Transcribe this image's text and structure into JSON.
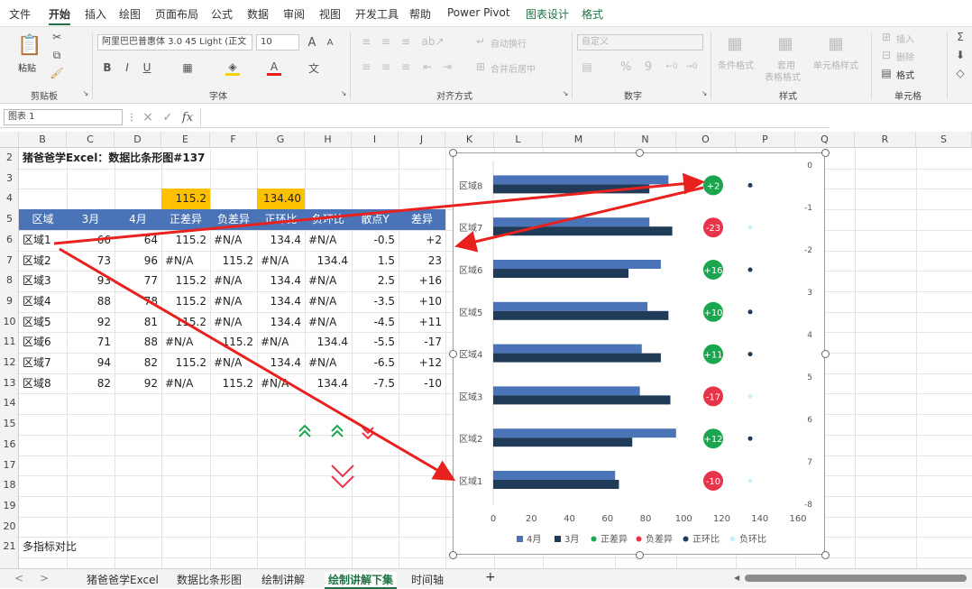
{
  "menu": {
    "items": [
      "文件",
      "开始",
      "插入",
      "绘图",
      "页面布局",
      "公式",
      "数据",
      "审阅",
      "视图",
      "开发工具",
      "帮助",
      "Power Pivot",
      "图表设计",
      "格式"
    ]
  },
  "ribbon": {
    "clipboard": {
      "paste": "粘贴",
      "label": "剪贴板"
    },
    "font": {
      "name": "阿里巴巴普惠体 3.0 45 Light (正文",
      "size": "10",
      "label": "字体",
      "bold": "B",
      "italic": "I",
      "underline": "U",
      "grow": "A",
      "shrink": "A",
      "color": "A"
    },
    "align": {
      "wrap": "自动换行",
      "merge": "合并后居中",
      "label": "对齐方式"
    },
    "number": {
      "format": "自定义",
      "percent": "%",
      "comma": "9",
      "label": "数字"
    },
    "styles": {
      "cond": "条件格式",
      "table_a": "套用",
      "table_b": "表格格式",
      "cell": "单元格样式",
      "label": "样式"
    },
    "cells": {
      "insert": "插入",
      "delete": "删除",
      "format": "格式",
      "label": "单元格"
    }
  },
  "formula": {
    "namebox": "图表 1",
    "fx": "fx",
    "cancel": "×",
    "confirm": "✓"
  },
  "columns": [
    "B",
    "C",
    "D",
    "E",
    "F",
    "G",
    "H",
    "I",
    "J",
    "K",
    "L",
    "M",
    "N",
    "O",
    "P",
    "Q",
    "R",
    "S"
  ],
  "rows": [
    "2",
    "3",
    "4",
    "5",
    "6",
    "7",
    "8",
    "9",
    "10",
    "11",
    "12",
    "13",
    "14",
    "15",
    "16",
    "17",
    "18",
    "19",
    "20",
    "21"
  ],
  "sheet": {
    "title": "猪爸爸学Excel：数据比条形图#137",
    "helper_e": "115.2",
    "helper_g": "134.40",
    "headers": [
      "区域",
      "3月",
      "4月",
      "正差异",
      "负差异",
      "正环比",
      "负环比",
      "散点Y",
      "差异"
    ],
    "data": [
      [
        "区域1",
        "66",
        "64",
        "115.2",
        "#N/A",
        "134.4",
        "#N/A",
        "-0.5",
        "+2"
      ],
      [
        "区域2",
        "73",
        "96",
        "#N/A",
        "115.2",
        "#N/A",
        "134.4",
        "1.5",
        "23"
      ],
      [
        "区域3",
        "93",
        "77",
        "115.2",
        "#N/A",
        "134.4",
        "#N/A",
        "2.5",
        "+16"
      ],
      [
        "区域4",
        "88",
        "78",
        "115.2",
        "#N/A",
        "134.4",
        "#N/A",
        "-3.5",
        "+10"
      ],
      [
        "区域5",
        "92",
        "81",
        "115.2",
        "#N/A",
        "134.4",
        "#N/A",
        "-4.5",
        "+11"
      ],
      [
        "区域6",
        "71",
        "88",
        "#N/A",
        "115.2",
        "#N/A",
        "134.4",
        "-5.5",
        "-17"
      ],
      [
        "区域7",
        "94",
        "82",
        "115.2",
        "#N/A",
        "134.4",
        "#N/A",
        "-6.5",
        "+12"
      ],
      [
        "区域8",
        "82",
        "92",
        "#N/A",
        "115.2",
        "#N/A",
        "134.4",
        "-7.5",
        "-10"
      ]
    ],
    "footer": "多指标对比"
  },
  "chart_data": {
    "type": "bar",
    "categories": [
      "区域8",
      "区域7",
      "区域6",
      "区域5",
      "区域4",
      "区域3",
      "区域2",
      "区域1"
    ],
    "series": [
      {
        "name": "4月",
        "color": "#4a74b7",
        "values": [
          92,
          82,
          88,
          81,
          78,
          77,
          96,
          64
        ]
      },
      {
        "name": "3月",
        "color": "#1f3b57",
        "values": [
          82,
          94,
          71,
          92,
          88,
          93,
          73,
          66
        ]
      }
    ],
    "diff_labels": [
      "+2",
      "-23",
      "+16",
      "+10",
      "+11",
      "-17",
      "+12",
      "-10"
    ],
    "diff_colors": [
      "#1aa64f",
      "#e8344a",
      "#1aa64f",
      "#1aa64f",
      "#1aa64f",
      "#e8344a",
      "#1aa64f",
      "#e8344a"
    ],
    "dot_colors": [
      "#1f3b57",
      "#cdeff7",
      "#1f3b57",
      "#1f3b57",
      "#1f3b57",
      "#cdeff7",
      "#1f3b57",
      "#cdeff7"
    ],
    "xticks": [
      "0",
      "20",
      "40",
      "60",
      "80",
      "100",
      "120",
      "140",
      "160"
    ],
    "xlim": [
      0,
      160
    ],
    "yticks_right": [
      "0",
      "-1",
      "-2",
      "3",
      "4",
      "5",
      "6",
      "7",
      "-8"
    ],
    "legend": [
      {
        "label": "4月",
        "shape": "square",
        "color": "#4a74b7"
      },
      {
        "label": "3月",
        "shape": "square",
        "color": "#1f3b57"
      },
      {
        "label": "正差异",
        "shape": "dot",
        "color": "#1aa64f"
      },
      {
        "label": "负差异",
        "shape": "dot",
        "color": "#e8344a"
      },
      {
        "label": "正环比",
        "shape": "dot",
        "color": "#1f3b57"
      },
      {
        "label": "负环比",
        "shape": "dot",
        "color": "#cdeff7"
      }
    ],
    "legend_position": "bottom"
  },
  "tabs": {
    "nav_prev": "<",
    "nav_next": ">",
    "sheets": [
      "猪爸爸学Excel",
      "数据比条形图",
      "绘制讲解",
      "绘制讲解下集",
      "时间轴"
    ],
    "active": "绘制讲解下集",
    "add": "+"
  },
  "colors": {
    "excel_green": "#217346",
    "header_blue": "#4a74b7",
    "helper_yellow": "#ffc000",
    "arrow_red": "#e8211f",
    "chevron_green": "#1aa64f",
    "chevron_red": "#e8344a"
  }
}
